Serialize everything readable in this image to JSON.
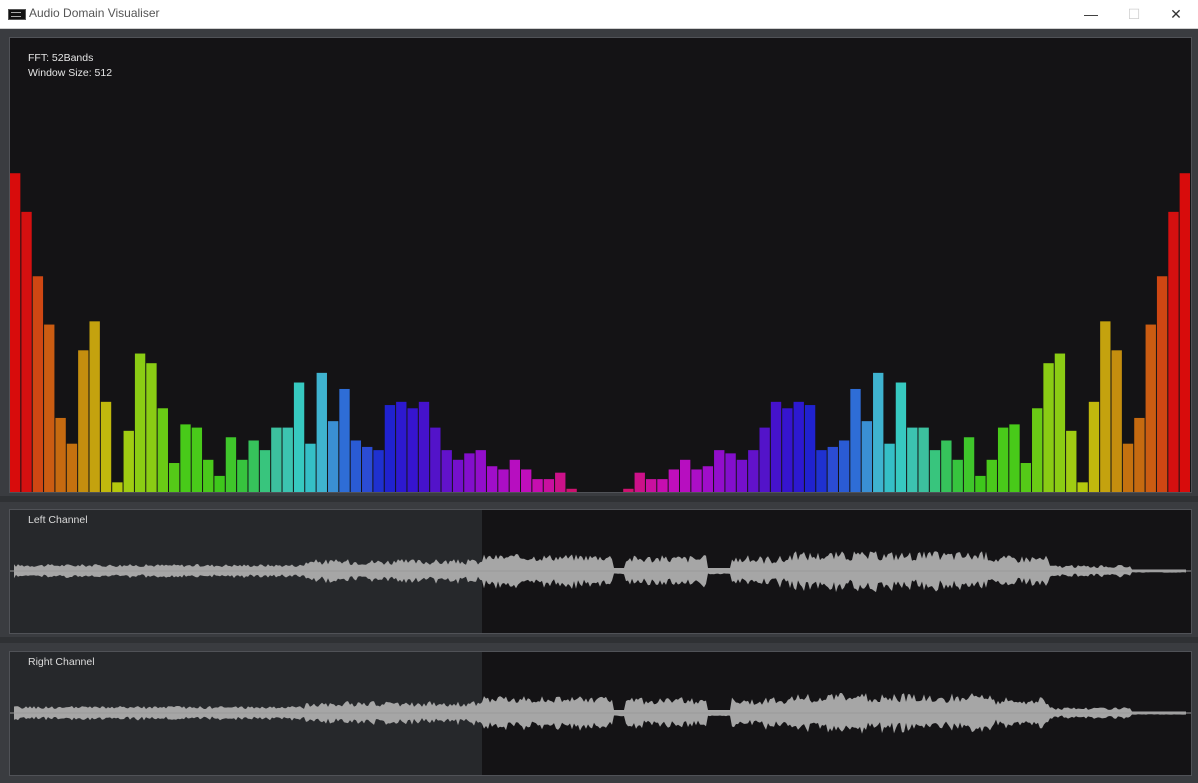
{
  "window": {
    "title": "Audio Domain Visualiser",
    "buttons": {
      "minimize": "—",
      "maximize": "☐",
      "close": "✕"
    }
  },
  "spectrum": {
    "fft_label": "FFT: 52Bands",
    "window_label": "Window Size: 512"
  },
  "left_channel": {
    "label": "Left Channel",
    "played_fraction": 0.4
  },
  "right_channel": {
    "label": "Right Channel",
    "played_fraction": 0.4
  },
  "chart_data": {
    "type": "bar",
    "bands": 52,
    "mirrored": true,
    "ylim": [
      0,
      1
    ],
    "values": [
      0.99,
      0.87,
      0.67,
      0.52,
      0.23,
      0.15,
      0.44,
      0.53,
      0.28,
      0.03,
      0.19,
      0.43,
      0.4,
      0.26,
      0.09,
      0.21,
      0.2,
      0.1,
      0.05,
      0.17,
      0.1,
      0.16,
      0.13,
      0.2,
      0.2,
      0.34,
      0.15,
      0.37,
      0.22,
      0.32,
      0.16,
      0.14,
      0.13,
      0.27,
      0.28,
      0.26,
      0.28,
      0.2,
      0.13,
      0.1,
      0.12,
      0.13,
      0.08,
      0.07,
      0.1,
      0.07,
      0.04,
      0.04,
      0.06,
      0.01,
      0.0,
      0.0
    ],
    "colors": [
      "#d80c0c",
      "#d51010",
      "#cf4713",
      "#cb5c12",
      "#c66a10",
      "#c5710f",
      "#c48e0f",
      "#c4a20e",
      "#c1b90d",
      "#b5c90d",
      "#a0cc12",
      "#8bcc14",
      "#8acc14",
      "#6acb15",
      "#55ca18",
      "#48ca19",
      "#49ca1a",
      "#4ac91b",
      "#3ec71c",
      "#3fc62b",
      "#37c43e",
      "#36c35b",
      "#38c57d",
      "#3cc09e",
      "#3cc3b0",
      "#37c9c0",
      "#35bfc6",
      "#3fb3cf",
      "#3a8fd3",
      "#2e6dd6",
      "#2a5bd4",
      "#2b4cd4",
      "#1f31d0",
      "#2022cf",
      "#2d19d0",
      "#3614cf",
      "#4512cc",
      "#5313c9",
      "#6212cb",
      "#7510cb",
      "#830fcc",
      "#920ecb",
      "#a00ec9",
      "#ab0ec6",
      "#b70ec0",
      "#c00ebc",
      "#c60eb0",
      "#c9109f",
      "#cc1189",
      "#cd1270",
      "#ce1458",
      "#d01744"
    ]
  }
}
